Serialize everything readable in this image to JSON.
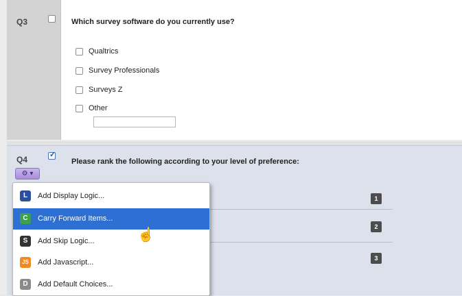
{
  "q3": {
    "number": "Q3",
    "question": "Which survey software do you currently use?",
    "options": [
      "Qualtrics",
      "Survey Professionals",
      "Surveys Z",
      "Other"
    ]
  },
  "q4": {
    "number": "Q4",
    "question": "Please rank the following according to your level of preference:",
    "ranks": [
      "1",
      "2",
      "3"
    ],
    "gear_label": "⚙ ▾"
  },
  "menu": {
    "items": [
      {
        "label": "Add Display Logic...",
        "icon": "display-logic-icon",
        "color": "#2b4f9e",
        "glyph": "L"
      },
      {
        "label": "Carry Forward Items...",
        "icon": "carry-forward-icon",
        "color": "#3aa24a",
        "glyph": "C"
      },
      {
        "label": "Add Skip Logic...",
        "icon": "skip-logic-icon",
        "color": "#333333",
        "glyph": "S"
      },
      {
        "label": "Add Javascript...",
        "icon": "javascript-icon",
        "color": "#f08a24",
        "glyph": "JS"
      },
      {
        "label": "Add Default Choices...",
        "icon": "default-choices-icon",
        "color": "#8a8a8a",
        "glyph": "D"
      }
    ],
    "active_index": 1
  }
}
